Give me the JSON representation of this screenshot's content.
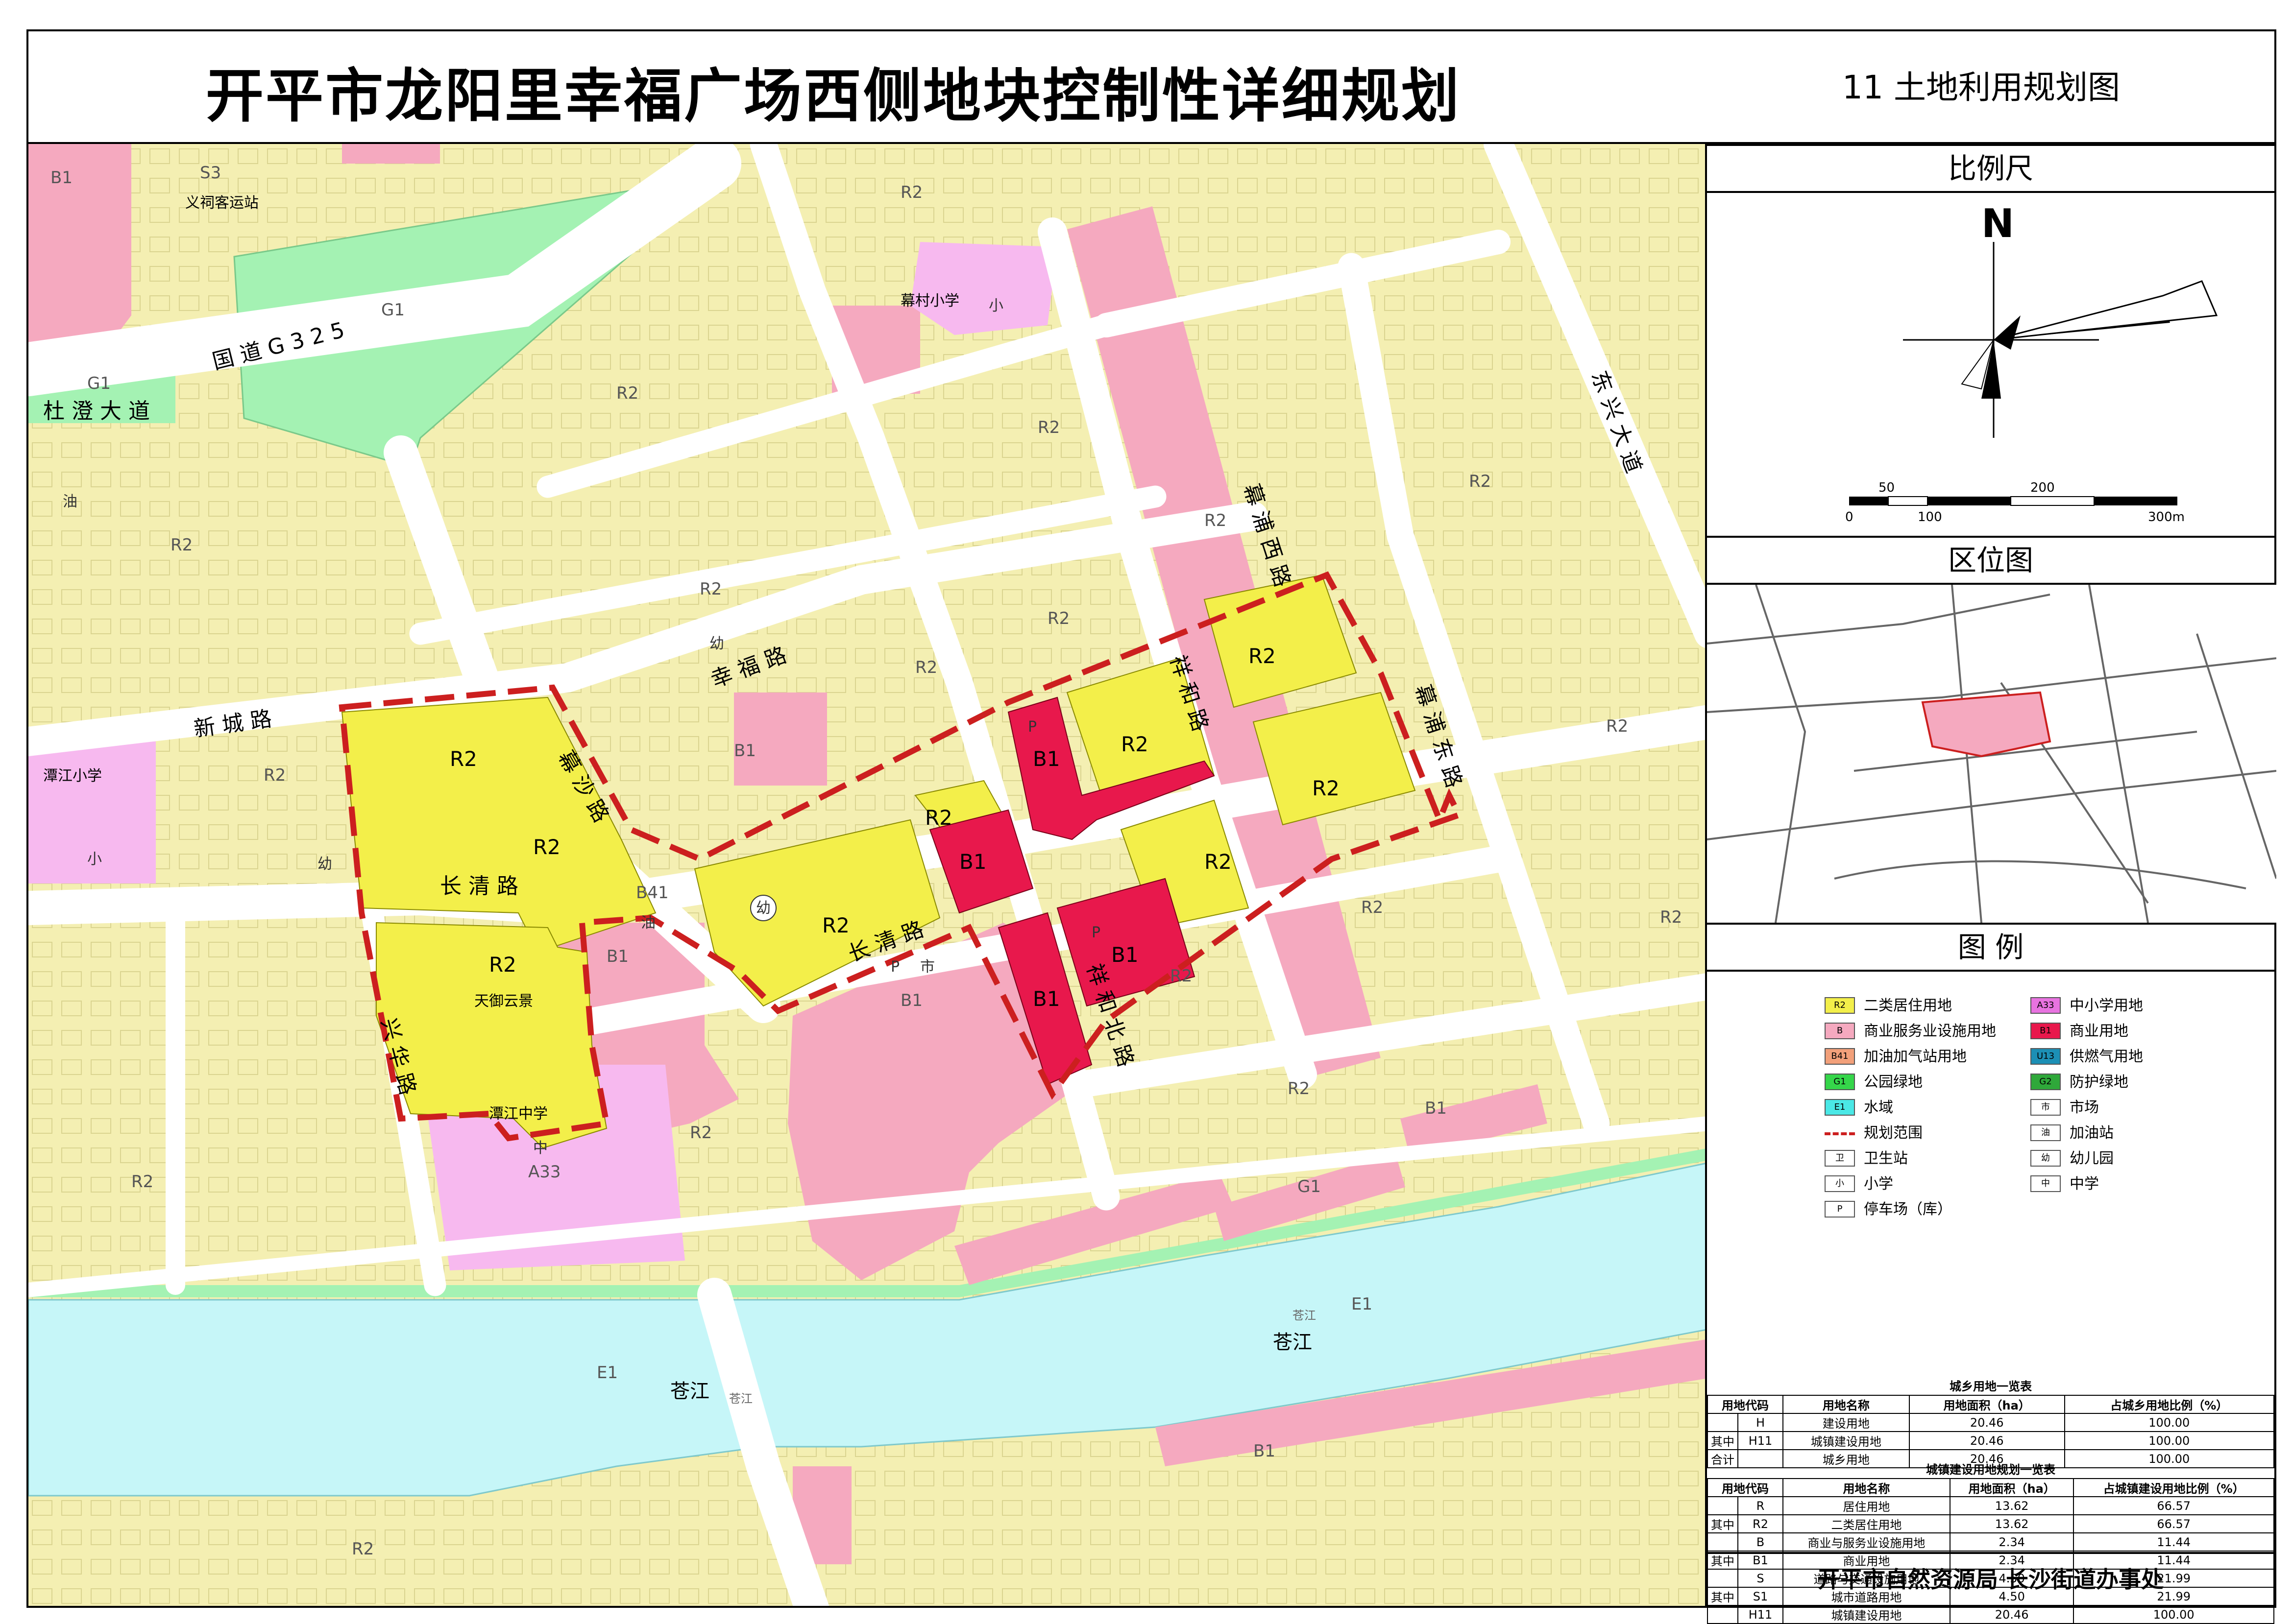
{
  "header": {
    "main_title": "开平市龙阳里幸福广场西侧地块控制性详细规划",
    "sheet_title": "11  土地利用规划图"
  },
  "colors": {
    "residential_r2": "#f4efb2",
    "plan_residential": "#f3ef4a",
    "commercial_service_b": "#f5a9bf",
    "commercial_b1": "#e8184c",
    "education_a33": "#f7b9ef",
    "green_g1": "#a4f2b3",
    "water_e1": "#c6f6f8",
    "plan_boundary": "#cc1f1f",
    "road": "#ffffff"
  },
  "map": {
    "roads": {
      "du_cheng": "杜 澄 大 道",
      "g325": "国 道 G 3 2 5",
      "dong_xing": "东 兴 大 道",
      "xin_cheng": "新 城 路",
      "xing_fu": "幸 福 路",
      "mu_sha": "幕 沙 路",
      "chang_qing_w": "长 清 路",
      "chang_qing_e": "长 清 路",
      "xing_hua": "兴 华 路",
      "xiang_he": "祥 和 路",
      "mu_pu_xi": "幕 浦 西 路",
      "mu_pu_dong": "幕 浦 东 路",
      "xiang_he_bei": "祥 和 北 路"
    },
    "places": {
      "yici_station": "义祠客运站",
      "mucun_school": "幕村小学",
      "tanjiang_primary": "潭江小学",
      "tanjiang_middle": "潭江中学",
      "tianyu_yunjing": "天御云景",
      "cangjiang_1": "苍江",
      "cangjiang_2": "苍江",
      "cangjiang_small_1": "苍江",
      "cangjiang_small_2": "苍江"
    },
    "codes": {
      "s3": "S3",
      "b1": "B1",
      "g1": "G1",
      "r2": "R2",
      "a33": "A33",
      "e1": "E1",
      "b41": "B41"
    },
    "symbols": {
      "you": "油",
      "you_er": "幼",
      "xiao": "小",
      "zhong": "中",
      "shi": "市",
      "p": "P"
    }
  },
  "panel": {
    "scale_head": "比例尺",
    "north": "N",
    "scale_labels": {
      "s50": "50",
      "s200": "200",
      "s0": "0",
      "s100": "100",
      "s300": "300m"
    },
    "location_head": "区位图",
    "legend_head": "图   例",
    "legend_left": [
      {
        "code": "R2",
        "label": "二类居住用地",
        "color": "#f3ef4a"
      },
      {
        "code": "B",
        "label": "商业服务业设施用地",
        "color": "#f5a9bf"
      },
      {
        "code": "B41",
        "label": "加油加气站用地",
        "color": "#f2a07a"
      },
      {
        "code": "G1",
        "label": "公园绿地",
        "color": "#35d64a"
      },
      {
        "code": "E1",
        "label": "水域",
        "color": "#4ae8e6"
      },
      {
        "code": "",
        "label": "规划范围",
        "color": "dash"
      },
      {
        "code": "卫",
        "label": "卫生站",
        "color": "#ffffff"
      },
      {
        "code": "小",
        "label": "小学",
        "color": "#ffffff"
      },
      {
        "code": "P",
        "label": "停车场（库）",
        "color": "#ffffff"
      }
    ],
    "legend_right": [
      {
        "code": "A33",
        "label": "中小学用地",
        "color": "#e873e0"
      },
      {
        "code": "B1",
        "label": "商业用地",
        "color": "#e8184c"
      },
      {
        "code": "U13",
        "label": "供燃气用地",
        "color": "#1c8fb5"
      },
      {
        "code": "G2",
        "label": "防护绿地",
        "color": "#2fa83a"
      },
      {
        "code": "市",
        "label": "市场",
        "color": "#ffffff"
      },
      {
        "code": "油",
        "label": "加油站",
        "color": "#ffffff"
      },
      {
        "code": "幼",
        "label": "幼儿园",
        "color": "#ffffff"
      },
      {
        "code": "中",
        "label": "中学",
        "color": "#ffffff"
      }
    ],
    "table1": {
      "caption": "城乡用地一览表",
      "headers": [
        "用地代码",
        "用地名称",
        "用地面积（ha）",
        "占城乡用地比例（%）"
      ],
      "rows": [
        [
          "",
          "H",
          "建设用地",
          "20.46",
          "100.00"
        ],
        [
          "其中",
          "H11",
          "城镇建设用地",
          "20.46",
          "100.00"
        ],
        [
          "合计",
          "",
          "城乡用地",
          "20.46",
          "100.00"
        ]
      ]
    },
    "table2": {
      "caption": "城镇建设用地规划一览表",
      "headers": [
        "用地代码",
        "用地名称",
        "用地面积（ha）",
        "占城镇建设用地比例（%）"
      ],
      "rows": [
        [
          "",
          "R",
          "居住用地",
          "13.62",
          "66.57"
        ],
        [
          "其中",
          "R2",
          "二类居住用地",
          "13.62",
          "66.57"
        ],
        [
          "",
          "B",
          "商业与服务业设施用地",
          "2.34",
          "11.44"
        ],
        [
          "其中",
          "B1",
          "商业用地",
          "2.34",
          "11.44"
        ],
        [
          "",
          "S",
          "道路与交通设施用地",
          "4.50",
          "21.99"
        ],
        [
          "其中",
          "S1",
          "城市道路用地",
          "4.50",
          "21.99"
        ],
        [
          "",
          "H11",
          "城镇建设用地",
          "20.46",
          "100.00"
        ]
      ]
    },
    "footer": "开平市自然资源局    长沙街道办事处"
  }
}
